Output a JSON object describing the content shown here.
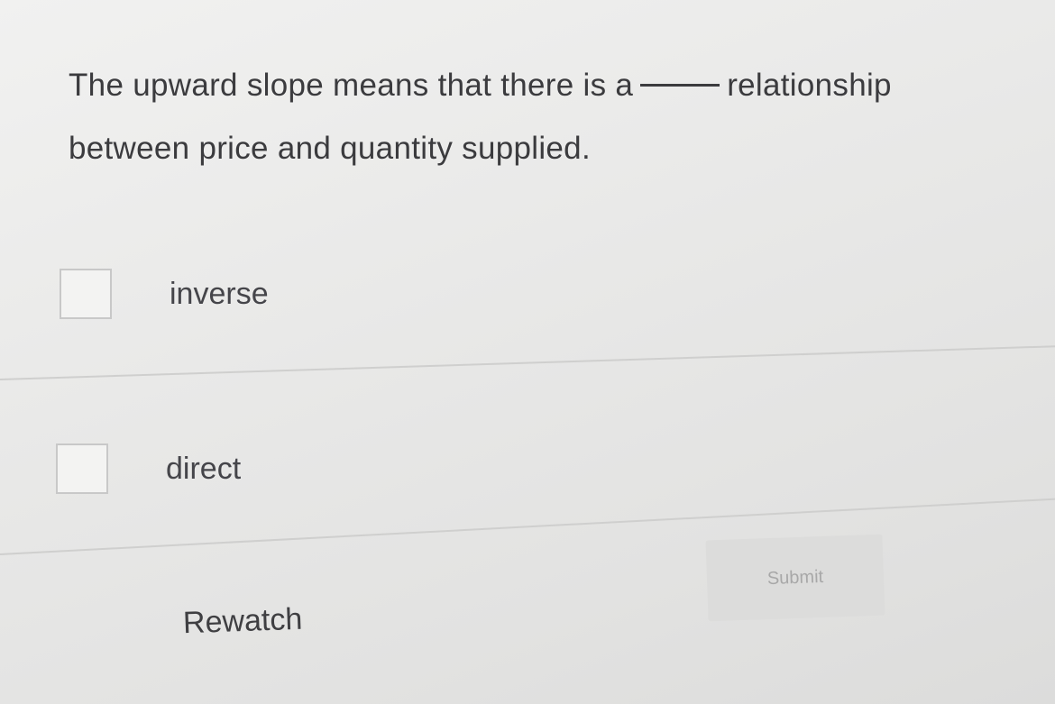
{
  "question": {
    "text_before": "The upward slope means that there is a",
    "text_after": "relationship between price and quantity supplied."
  },
  "options": [
    {
      "label": "inverse",
      "checked": false
    },
    {
      "label": "direct",
      "checked": false
    }
  ],
  "actions": {
    "rewatch_label": "Rewatch",
    "submit_label": "Submit",
    "submit_enabled": false
  }
}
